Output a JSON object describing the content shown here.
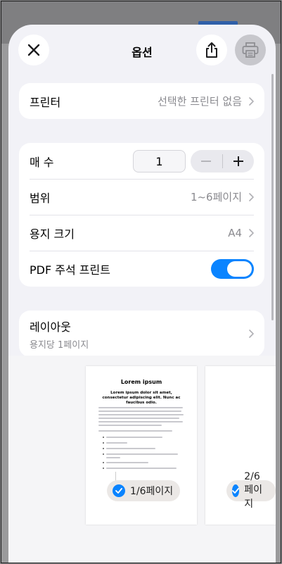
{
  "sheet": {
    "title": "옵션"
  },
  "printer": {
    "label": "프린터",
    "value": "선택한 프린터 없음"
  },
  "copies": {
    "label": "매 수",
    "value": "1",
    "minus": "−",
    "plus": "+"
  },
  "range": {
    "label": "범위",
    "value": "1~6페이지"
  },
  "paper_size": {
    "label": "용지 크기",
    "value": "A4"
  },
  "pdf_annotations": {
    "label": "PDF 주석 프린트",
    "enabled": true
  },
  "layout": {
    "label": "레이아웃",
    "value": "용지당 1페이지"
  },
  "preview": {
    "pages": [
      {
        "badge": "1/6페이지",
        "selected": true,
        "doc_title": "Lorem ipsum",
        "doc_subtitle": "Lorem ipsum dolor sit amet, consectetur adipiscing elit. Nunc ac faucibus odio."
      },
      {
        "badge": "2/6페이지",
        "selected": true
      }
    ]
  },
  "colors": {
    "accent": "#0a84ff",
    "sheet_bg": "#f2f2f7",
    "disabled_button": "#c7c7cc"
  },
  "icons": [
    "close-icon",
    "share-icon",
    "printer-icon",
    "chevron-right-icon",
    "checkmark-icon"
  ]
}
